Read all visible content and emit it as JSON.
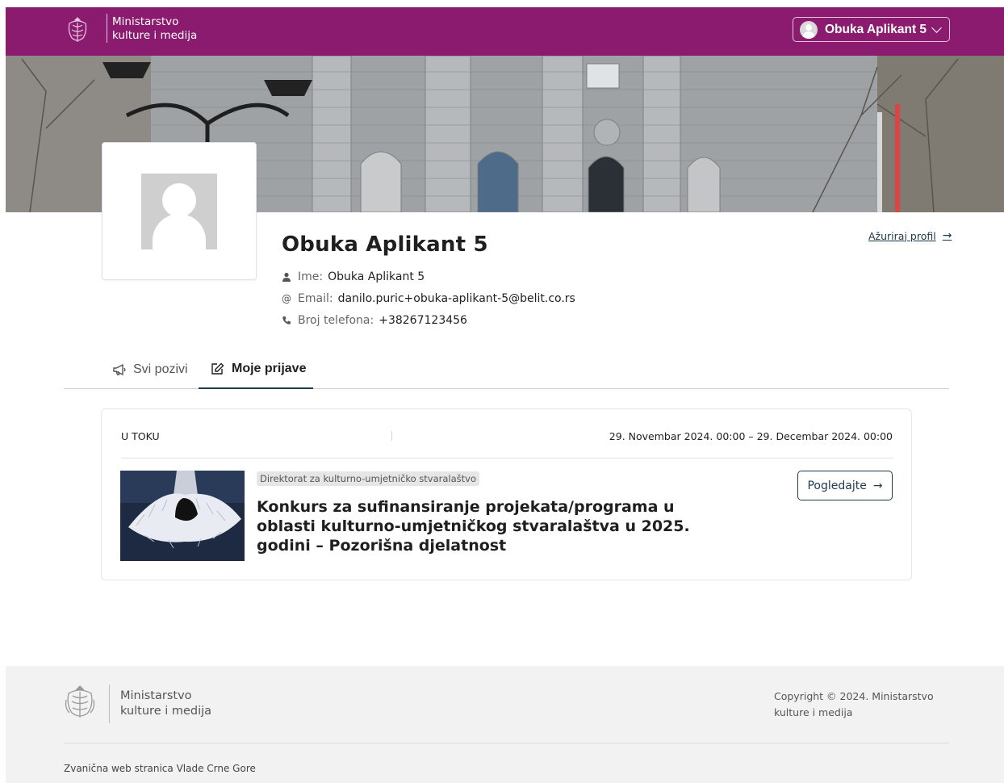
{
  "header": {
    "brand_line1": "Ministarstvo",
    "brand_line2": "kulture i medija",
    "user_name": "Obuka Aplikant 5"
  },
  "profile": {
    "name": "Obuka Aplikant 5",
    "ime_label": "Ime:",
    "ime_value": "Obuka Aplikant 5",
    "email_label": "Email:",
    "email_value": "danilo.puric+obuka-aplikant-5@belit.co.rs",
    "phone_label": "Broj telefona:",
    "phone_value": "+38267123456",
    "update_link": "Ažuriraj profil"
  },
  "tabs": [
    {
      "label": "Svi pozivi",
      "active": false
    },
    {
      "label": "Moje prijave",
      "active": true
    }
  ],
  "application": {
    "status": "U TOKU",
    "dates": "29. Novembar 2024. 00:00 – 29. Decembar 2024. 00:00",
    "tag": "Direktorat za kulturno-umjetničko stvaralaštvo",
    "title": "Konkurs za sufinansiranje projekata/programa u oblasti kulturno-umjetničkog stvaralaštva u 2025. godini – Pozorišna djelatnost",
    "button_label": "Pogledajte"
  },
  "footer": {
    "brand_line1": "Ministarstvo",
    "brand_line2": "kulture i medija",
    "copyright_line1": "Copyright © 2024. Ministarstvo",
    "copyright_line2": "kulture i medija",
    "official": "Zvanična web stranica Vlade Crne Gore"
  },
  "colors": {
    "brand": "#8a1b6e",
    "accent": "#1c3a4a",
    "footer_bg": "#f2f2f2"
  },
  "icons": {
    "crest": "coat-of-arms-icon",
    "user": "user-icon",
    "email": "at-icon",
    "phone": "phone-icon",
    "megaphone": "megaphone-icon",
    "edit": "edit-icon",
    "arrow": "arrow-right-icon",
    "chevron": "chevron-down-icon"
  }
}
